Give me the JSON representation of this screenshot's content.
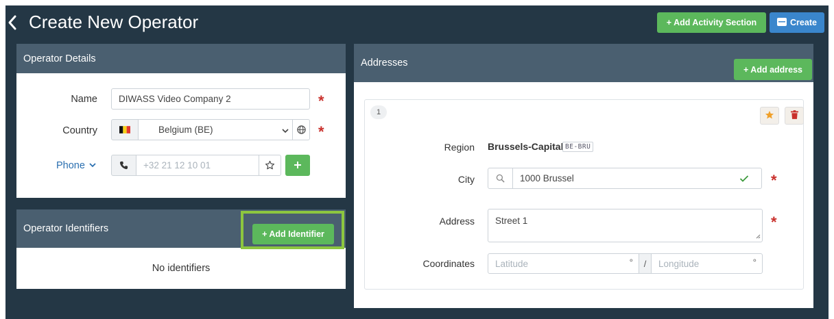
{
  "header": {
    "title": "Create New Operator",
    "add_activity_label": "+ Add Activity Section",
    "create_label": "Create"
  },
  "operator_details": {
    "title": "Operator Details",
    "name_label": "Name",
    "name_value": "DIWASS Video Company 2",
    "country_label": "Country",
    "country_value": "Belgium (BE)",
    "phone_label": "Phone",
    "phone_placeholder": "+32 21 12 10 01",
    "required_mark": "*"
  },
  "identifiers": {
    "title": "Operator Identifiers",
    "add_label": "+ Add Identifier",
    "empty_text": "No identifiers"
  },
  "addresses": {
    "title": "Addresses",
    "add_label": "+ Add address",
    "card": {
      "index": "1",
      "region_label": "Region",
      "region_value": "Brussels-Capital",
      "region_code": "BE-BRU",
      "city_label": "City",
      "city_value": "1000 Brussel",
      "address_label": "Address",
      "address_value": "Street 1",
      "coordinates_label": "Coordinates",
      "latitude_placeholder": "Latitude",
      "longitude_placeholder": "Longitude",
      "degree_symbol": "°",
      "separator": "/"
    }
  },
  "colors": {
    "background": "#243745",
    "panel_header": "#4a5f70",
    "green": "#5cb85c",
    "blue": "#3a86cc",
    "required": "#c9302c",
    "highlight": "#8dc63f"
  }
}
